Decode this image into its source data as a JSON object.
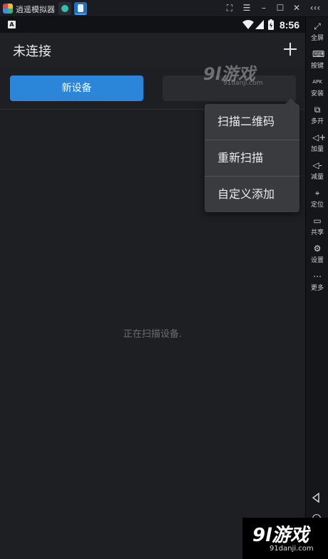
{
  "titlebar": {
    "app_title": "逍遥模拟器",
    "controls": [
      "⛶",
      "☰",
      "–",
      "☐",
      "✕",
      "‹‹‹"
    ]
  },
  "statusbar": {
    "keyboard_badge": "A",
    "time": "8:56"
  },
  "appbar": {
    "title": "未连接"
  },
  "tabs": {
    "new_device": "新设备"
  },
  "main": {
    "scanning_text": "正在扫描设备."
  },
  "menu": {
    "items": [
      "扫描二维码",
      "重新扫描",
      "自定义添加"
    ]
  },
  "sidebar": {
    "items": [
      {
        "icon": "fullscreen-icon",
        "label": "全屏"
      },
      {
        "icon": "keyboard-icon",
        "label": "按键"
      },
      {
        "icon": "apk-install-icon",
        "label": "安装"
      },
      {
        "icon": "multi-open-icon",
        "label": "多开"
      },
      {
        "icon": "volume-up-icon",
        "label": "加量"
      },
      {
        "icon": "volume-down-icon",
        "label": "减量"
      },
      {
        "icon": "location-icon",
        "label": "定位"
      },
      {
        "icon": "folder-share-icon",
        "label": "共享"
      },
      {
        "icon": "gear-icon",
        "label": "设置"
      },
      {
        "icon": "more-icon",
        "label": "更多"
      }
    ]
  },
  "watermark": {
    "brand": "9l游戏",
    "url_small": "91danji.com",
    "url_bottom": "91danji.com"
  },
  "colors": {
    "accent": "#2b86d9",
    "background": "#1e1f22",
    "menu": "#3a3b3f"
  }
}
